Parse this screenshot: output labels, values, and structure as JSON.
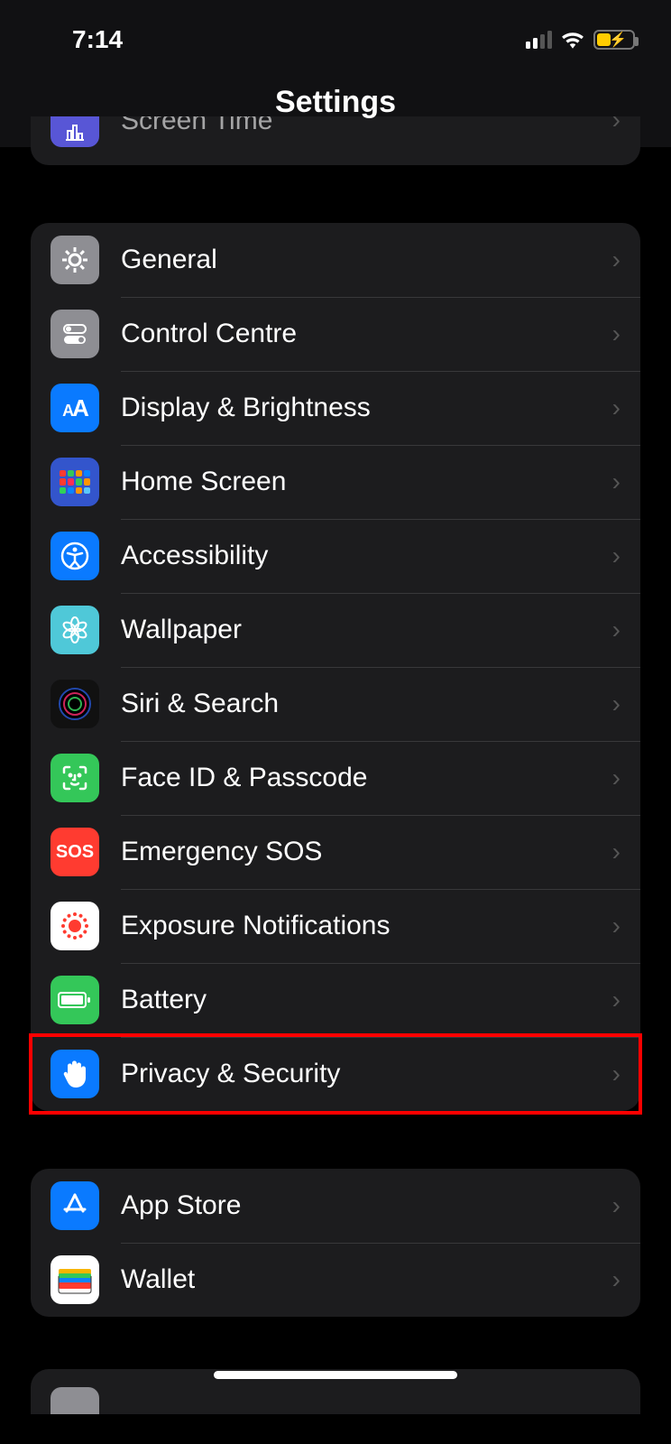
{
  "status": {
    "time": "7:14"
  },
  "header": {
    "title": "Settings"
  },
  "partial_top": {
    "label": "Screen Time"
  },
  "group_main": [
    {
      "label": "General",
      "icon": "gear",
      "bg": "#8e8e93"
    },
    {
      "label": "Control Centre",
      "icon": "toggles",
      "bg": "#8e8e93"
    },
    {
      "label": "Display & Brightness",
      "icon": "aa",
      "bg": "#0a7aff"
    },
    {
      "label": "Home Screen",
      "icon": "homegrid",
      "bg": "#3355cc"
    },
    {
      "label": "Accessibility",
      "icon": "access",
      "bg": "#0a7aff"
    },
    {
      "label": "Wallpaper",
      "icon": "flower",
      "bg": "#4fc8d8"
    },
    {
      "label": "Siri & Search",
      "icon": "siri",
      "bg": "#111"
    },
    {
      "label": "Face ID & Passcode",
      "icon": "face",
      "bg": "#34c759"
    },
    {
      "label": "Emergency SOS",
      "icon": "sos",
      "bg": "#ff3b30"
    },
    {
      "label": "Exposure Notifications",
      "icon": "exposure",
      "bg": "#ffffff"
    },
    {
      "label": "Battery",
      "icon": "battery",
      "bg": "#34c759"
    },
    {
      "label": "Privacy & Security",
      "icon": "hand",
      "bg": "#0a7aff"
    }
  ],
  "group_store": [
    {
      "label": "App Store",
      "icon": "appstore",
      "bg": "#0a7aff"
    },
    {
      "label": "Wallet",
      "icon": "wallet",
      "bg": "#ffffff"
    }
  ],
  "highlight_row_index": 11
}
